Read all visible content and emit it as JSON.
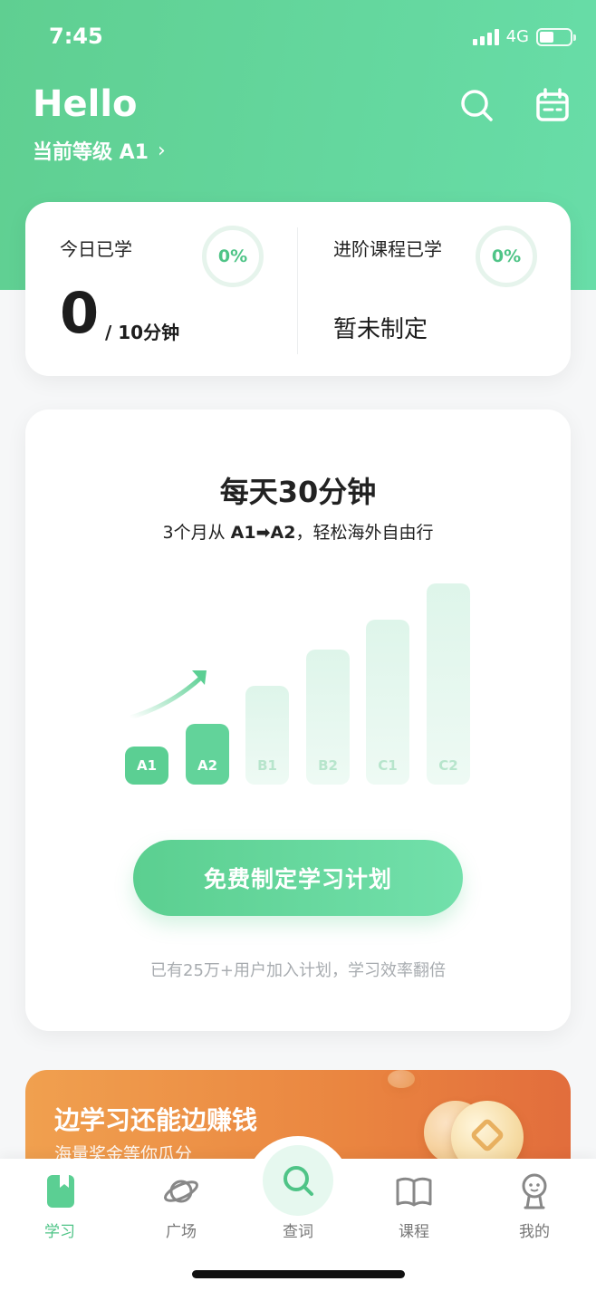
{
  "status_bar": {
    "time": "7:45",
    "network": "4G",
    "battery_level": 0.48
  },
  "header": {
    "greeting": "Hello",
    "level_label": "当前等级 A1",
    "chevron": "›"
  },
  "stats": {
    "today_label": "今日已学",
    "today_percent": "0%",
    "today_minutes": "0",
    "today_goal": "/ 10分钟",
    "advanced_label": "进阶课程已学",
    "advanced_percent": "0%",
    "advanced_status": "暂未制定"
  },
  "promo": {
    "title": "每天30分钟",
    "subtitle_prefix": "3个月从 ",
    "subtitle_bold": "A1➡A2",
    "subtitle_suffix": "，轻松海外自由行",
    "levels": [
      {
        "label": "A1",
        "state": "done",
        "height_fraction": 0.19
      },
      {
        "label": "A2",
        "state": "done",
        "height_fraction": 0.3
      },
      {
        "label": "B1",
        "state": "todo",
        "height_fraction": 0.49
      },
      {
        "label": "B2",
        "state": "todo",
        "height_fraction": 0.67
      },
      {
        "label": "C1",
        "state": "todo",
        "height_fraction": 0.82
      },
      {
        "label": "C2",
        "state": "todo",
        "height_fraction": 1.0
      }
    ],
    "cta_label": "免费制定学习计划",
    "note": "已有25万+用户加入计划，学习效率翻倍"
  },
  "banner": {
    "title": "边学习还能边赚钱",
    "subtitle": "海量奖金等你瓜分"
  },
  "tabs": [
    {
      "label": "学习",
      "icon": "book-bookmark-icon",
      "active": true
    },
    {
      "label": "广场",
      "icon": "planet-icon",
      "active": false
    },
    {
      "label": "查词",
      "icon": "search-icon",
      "active": false
    },
    {
      "label": "课程",
      "icon": "open-book-icon",
      "active": false
    },
    {
      "label": "我的",
      "icon": "profile-face-icon",
      "active": false
    }
  ],
  "colors": {
    "accent": "#5bcf93",
    "banner_orange": "#ea8540",
    "text_dark": "#1d1d1d"
  }
}
